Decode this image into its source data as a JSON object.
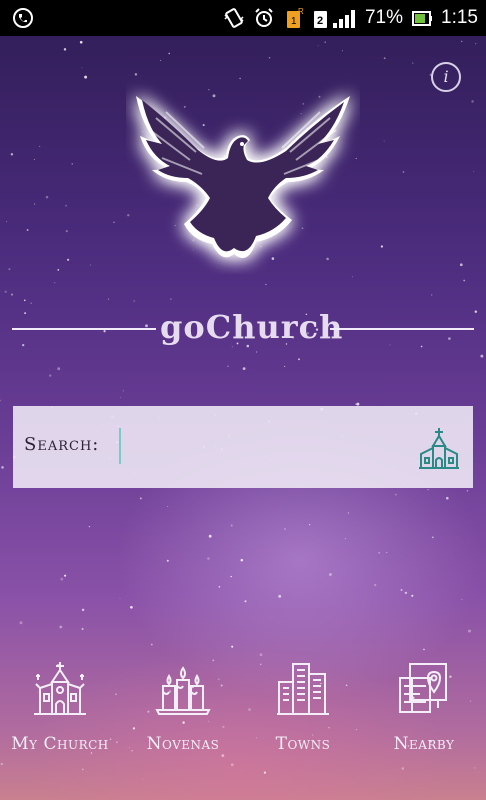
{
  "status_bar": {
    "battery": "71%",
    "time": "1:15",
    "sim_slot": "2",
    "icons": [
      "whatsapp-phone-icon",
      "vibrate-icon",
      "alarm-icon",
      "sim-1-icon",
      "sim-2-signal-icon",
      "battery-icon"
    ]
  },
  "header": {
    "info_icon": "info-icon",
    "info_glyph": "i"
  },
  "brand": {
    "name": "goChurch",
    "logo_icon": "dove-icon"
  },
  "search": {
    "label": "Search:",
    "value": "",
    "placeholder": "",
    "icon": "church-search-icon"
  },
  "nav": {
    "items": [
      {
        "label": "My Church",
        "icon": "church-icon"
      },
      {
        "label": "Novenas",
        "icon": "candles-icon"
      },
      {
        "label": "Towns",
        "icon": "city-buildings-icon"
      },
      {
        "label": "Nearby",
        "icon": "map-pin-icon"
      }
    ]
  },
  "colors": {
    "accent_teal": "#2a8a86",
    "text_light": "#f3eef8",
    "bg_top": "#2f1d55",
    "bg_bottom": "#c9808f"
  }
}
